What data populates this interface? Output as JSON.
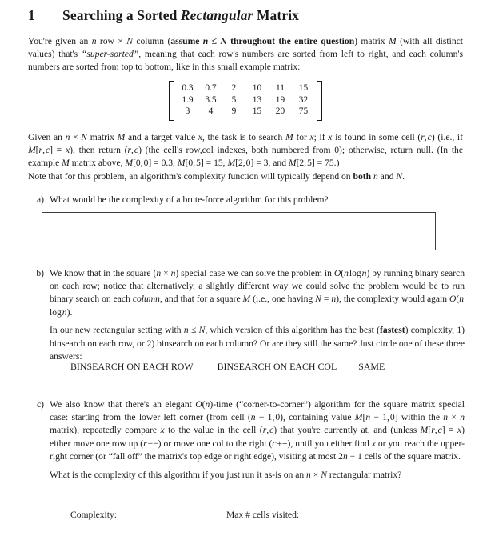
{
  "document": {
    "section_number": "1",
    "section_title_plain": "Searching a Sorted Rectangular Matrix",
    "section_title_parts": {
      "before": "Searching a Sorted ",
      "italic": "Rectangular",
      "after": " Matrix"
    }
  },
  "paragraphs": {
    "intro": "You're given an n row × N column (assume n ≤ N throughout the entire question) matrix M (with all distinct values) that's “super-sorted”, meaning that each row's numbers are sorted from left to right, and each column's numbers are sorted from top to bottom, like in this small example matrix:",
    "given": "Given an n × N matrix M and a target value x, the task is to search M for x; if x is found in some cell (r, c) (i.e., if M[r,c] = x), then return (r, c) (the cell's row,col indexes, both numbered from 0); otherwise, return null. (In the example M matrix above, M[0,0] = 0.3, M[0,5] = 15, M[2,0] = 3, and M[2,5] = 75.)",
    "note": "Note that for this problem, an algorithm's complexity function will typically depend on both n and N."
  },
  "matrix": {
    "rows": 3,
    "cols": 6,
    "values": [
      [
        "0.3",
        "0.7",
        "2",
        "10",
        "11",
        "15"
      ],
      [
        "1.9",
        "3.5",
        "5",
        "13",
        "19",
        "32"
      ],
      [
        "3",
        "4",
        "9",
        "15",
        "20",
        "75"
      ]
    ]
  },
  "items": {
    "a": {
      "label": "a)",
      "text": "What would be the complexity of a brute-force algorithm for this problem?",
      "answer_box_value": ""
    },
    "b": {
      "label": "b)",
      "paragraph1": "We know that in the square (n × n) special case we can solve the problem in O(n log n) by running binary search on each row; notice that alternatively, a slightly different way we could solve the problem would be to run binary search on each column, and that for a square M (i.e., one having N = n), the complexity would again O(n log n).",
      "paragraph2": "In our new rectangular setting with n ≤ N, which version of this algorithm has the best (fastest) complexity, 1) binsearch on each row, or 2) binsearch on each column? Or are they still the same? Just circle one of these three answers:",
      "choices": [
        "BINSEARCH ON EACH ROW",
        "BINSEARCH ON EACH COL",
        "SAME"
      ]
    },
    "c": {
      "label": "c)",
      "paragraph1": "We also know that there's an elegant O(n)-time (“corner-to-corner”) algorithm for the square matrix special case: starting from the lower left corner (from cell (n − 1, 0), containing value M[n − 1, 0] within the n × n matrix), repeatedly compare x to the value in the cell (r, c) that you're currently at, and (unless M[r,c] = x) either move one row up (r − −) or move one col to the right (c + +), until you either find x or you reach the upper-right corner (or “fall off” the matrix's top edge or right edge), visiting at most 2n − 1 cells of the square matrix.",
      "paragraph2": "What is the complexity of this algorithm if you just run it as-is on an n × N rectangular matrix?",
      "prompts": {
        "complexity_label": "Complexity:",
        "complexity_value": "",
        "max_cells_label": "Max # cells visited:",
        "max_cells_value": ""
      }
    }
  },
  "colors": {
    "text": "#1a1a1a",
    "background": "#ffffff",
    "box_border": "#3c3c3c"
  }
}
